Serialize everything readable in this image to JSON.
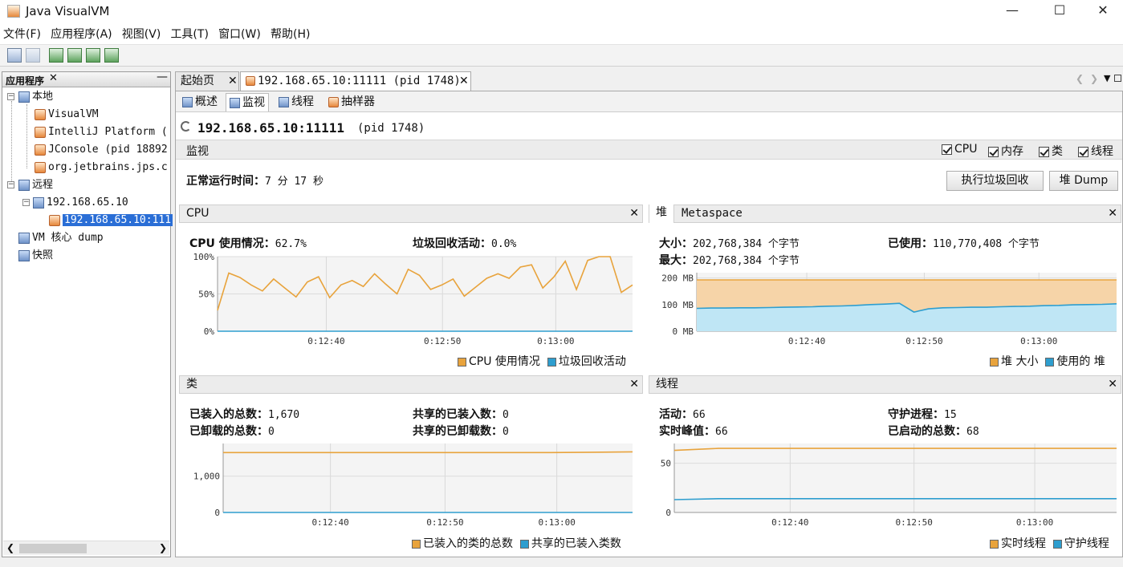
{
  "window": {
    "title": "Java VisualVM",
    "minimize": "—",
    "maximize": "☐",
    "close": "✕"
  },
  "menu": [
    "文件(F)",
    "应用程序(A)",
    "视图(V)",
    "工具(T)",
    "窗口(W)",
    "帮助(H)"
  ],
  "left_panel": {
    "title": "应用程序",
    "tree": {
      "local": "本地",
      "visualvm": "VisualVM",
      "intellij": "IntelliJ Platform (",
      "jconsole": "JConsole (pid 18892",
      "jps": "org.jetbrains.jps.c",
      "remote": "远程",
      "remote_host": "192.168.65.10",
      "remote_app": "192.168.65.10:111",
      "vm_dump": "VM 核心 dump",
      "snapshot": "快照"
    }
  },
  "tabs": {
    "start": "起始页",
    "app": "192.168.65.10:11111 (pid 1748)"
  },
  "subtabs": [
    "概述",
    "监视",
    "线程",
    "抽样器"
  ],
  "header": {
    "host": "192.168.65.10:11111",
    "pid": "(pid 1748)"
  },
  "monitor": {
    "label": "监视",
    "checkboxes": [
      "CPU",
      "内存",
      "类",
      "线程"
    ],
    "uptime_label": "正常运行时间：",
    "uptime_value": "7 分 17 秒",
    "gc_button": "执行垃圾回收",
    "heap_dump_button": "堆 Dump"
  },
  "cpu_panel": {
    "title": "CPU",
    "usage_label": "CPU 使用情况：",
    "usage_value": "62.7%",
    "gc_label": "垃圾回收活动：",
    "gc_value": "0.0%",
    "legend": [
      "CPU 使用情况",
      "垃圾回收活动"
    ]
  },
  "heap_panel": {
    "tab_heap": "堆",
    "tab_meta": "Metaspace",
    "size_label": "大小：",
    "size_value": "202,768,384 个字节",
    "max_label": "最大：",
    "max_value": "202,768,384 个字节",
    "used_label": "已使用：",
    "used_value": "110,770,408 个字节",
    "legend": [
      "堆 大小",
      "使用的 堆"
    ]
  },
  "classes_panel": {
    "title": "类",
    "loaded_label": "已装入的总数：",
    "loaded_value": "1,670",
    "unloaded_label": "已卸载的总数：",
    "unloaded_value": "0",
    "shared_loaded_label": "共享的已装入数：",
    "shared_loaded_value": "0",
    "shared_unloaded_label": "共享的已卸载数：",
    "shared_unloaded_value": "0",
    "legend": [
      "已装入的类的总数",
      "共享的已装入类数"
    ]
  },
  "threads_panel": {
    "title": "线程",
    "live_label": "活动：",
    "live_value": "66",
    "peak_label": "实时峰值：",
    "peak_value": "66",
    "daemon_label": "守护进程：",
    "daemon_value": "15",
    "started_label": "已启动的总数：",
    "started_value": "68",
    "legend": [
      "实时线程",
      "守护线程"
    ]
  },
  "colors": {
    "orange": "#e8a33c",
    "orange_fill": "#f6d4a8",
    "blue": "#2e9ecf",
    "blue_fill": "#bfe6f5"
  },
  "chart_data": [
    {
      "type": "line",
      "name": "cpu",
      "x_ticks": [
        "0:12:40",
        "0:12:50",
        "0:13:00"
      ],
      "y_ticks": [
        "0%",
        "50%",
        "100%"
      ],
      "ylim": [
        0,
        100
      ],
      "series": [
        {
          "name": "CPU 使用情况",
          "color": "#e8a33c",
          "values": [
            28,
            78,
            72,
            62,
            54,
            70,
            58,
            46,
            66,
            73,
            45,
            62,
            68,
            60,
            77,
            63,
            50,
            83,
            75,
            56,
            62,
            70,
            47,
            59,
            71,
            77,
            71,
            86,
            89,
            58,
            73,
            94,
            56,
            95,
            100,
            100,
            52,
            62
          ]
        },
        {
          "name": "垃圾回收活动",
          "color": "#2e9ecf",
          "values": [
            0,
            0,
            0,
            0,
            0,
            0,
            0,
            0,
            0,
            0,
            0,
            0,
            0,
            0,
            0,
            0,
            0,
            0,
            0,
            0,
            0,
            0,
            0,
            0,
            0,
            0,
            0,
            0,
            0,
            0,
            0,
            0,
            0,
            0,
            0,
            0,
            0,
            0
          ]
        }
      ]
    },
    {
      "type": "area",
      "name": "heap",
      "x_ticks": [
        "0:12:40",
        "0:12:50",
        "0:13:00"
      ],
      "y_ticks": [
        "0 MB",
        "100 MB",
        "200 MB"
      ],
      "ylim": [
        0,
        220
      ],
      "series": [
        {
          "name": "堆 大小",
          "color": "#e8a33c",
          "values": [
            193,
            193,
            193,
            193,
            193,
            193,
            193,
            193,
            193,
            193,
            193,
            193,
            193,
            193,
            193,
            193,
            193,
            193,
            193,
            193,
            193,
            193,
            193,
            193,
            193,
            193,
            193,
            193,
            193,
            193
          ]
        },
        {
          "name": "使用的 堆",
          "color": "#2e9ecf",
          "values": [
            86,
            87,
            87,
            88,
            88,
            89,
            90,
            91,
            92,
            94,
            95,
            97,
            100,
            102,
            105,
            72,
            84,
            88,
            89,
            90,
            90,
            92,
            93,
            94,
            96,
            97,
            99,
            100,
            101,
            103
          ]
        }
      ]
    },
    {
      "type": "line",
      "name": "classes",
      "x_ticks": [
        "0:12:40",
        "0:12:50",
        "0:13:00"
      ],
      "y_ticks": [
        "0",
        "1,000"
      ],
      "ylim": [
        0,
        1900
      ],
      "series": [
        {
          "name": "已装入的类的总数",
          "color": "#e8a33c",
          "values": [
            1650,
            1650,
            1650,
            1650,
            1650,
            1650,
            1650,
            1650,
            1650,
            1660,
            1670
          ]
        },
        {
          "name": "共享的已装入类数",
          "color": "#2e9ecf",
          "values": [
            0,
            0,
            0,
            0,
            0,
            0,
            0,
            0,
            0,
            0,
            0
          ]
        }
      ]
    },
    {
      "type": "line",
      "name": "threads",
      "x_ticks": [
        "0:12:40",
        "0:12:50",
        "0:13:00"
      ],
      "y_ticks": [
        "0",
        "50"
      ],
      "ylim": [
        0,
        70
      ],
      "series": [
        {
          "name": "实时线程",
          "color": "#e8a33c",
          "values": [
            63,
            65,
            65,
            65,
            65,
            65,
            65,
            65,
            65,
            65,
            65
          ]
        },
        {
          "name": "守护线程",
          "color": "#2e9ecf",
          "values": [
            13,
            14,
            14,
            14,
            14,
            14,
            14,
            14,
            14,
            14,
            14
          ]
        }
      ]
    }
  ]
}
